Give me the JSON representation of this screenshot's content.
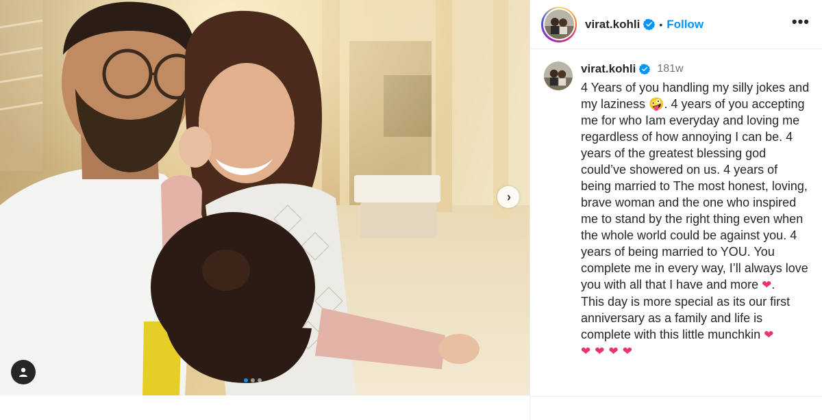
{
  "post": {
    "username": "virat.kohli",
    "verified": true,
    "follow_label": "Follow",
    "separator": "•",
    "more_label": "•••",
    "timestamp": "181w",
    "caption_paragraph_1": "4 Years of you handling my silly jokes and my laziness 🤪. 4 years of you accepting me for who Iam everyday and loving me regardless of how annoying I can be. 4 years of the greatest blessing god could’ve showered on us. 4 years of being married to The most honest, loving, brave woman and the one who inspired me to stand by the right thing even when the whole world could be against you. 4 years of being married to YOU. You complete me in every way, I’ll always love you with all that I have and more",
    "caption_paragraph_1_end": ".",
    "caption_paragraph_2": "This day is more special as its our first anniversary as a family and life is complete with this little munchkin",
    "hearts_row": "❤❤❤❤",
    "inline_heart": "❤"
  },
  "carousel": {
    "total_slides": 3,
    "active_index": 0,
    "next_icon": "chevron-right-icon",
    "tag_icon": "user-tag-icon"
  },
  "colors": {
    "accent": "#0095f6",
    "heart": "#e8336d",
    "verified": "#0095f6",
    "muted": "#737373"
  }
}
